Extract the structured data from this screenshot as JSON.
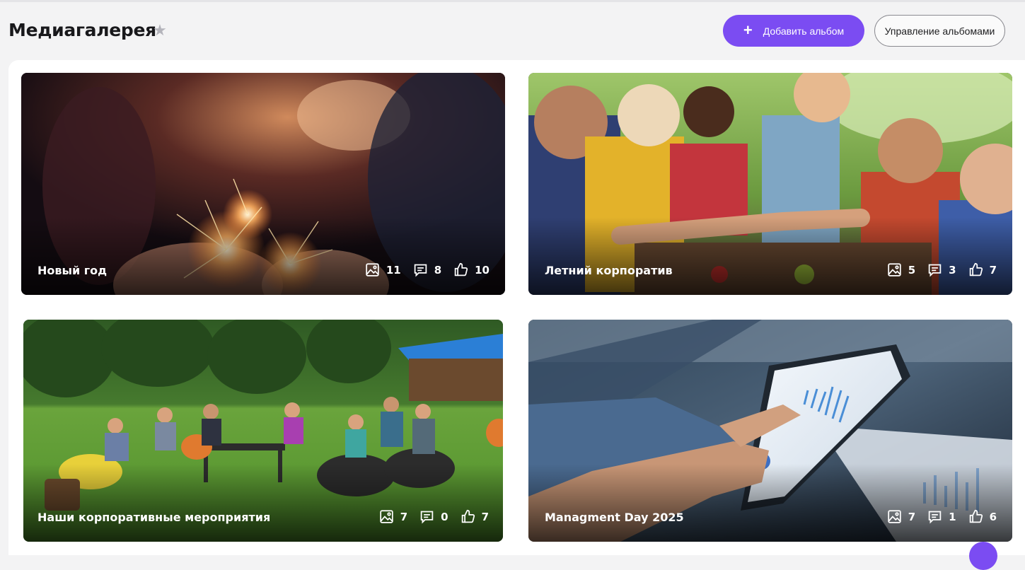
{
  "header": {
    "title": "Медиагалерея",
    "add_album_label": "Добавить альбом",
    "manage_albums_label": "Управление альбомами"
  },
  "icons": {
    "favorite": "star-icon",
    "add": "plus-icon",
    "photos": "image-icon",
    "comments": "comment-icon",
    "likes": "thumbs-up-icon"
  },
  "colors": {
    "accent": "#7b4cf2",
    "background": "#f3f3f4",
    "panel": "#ffffff"
  },
  "albums": [
    {
      "title": "Новый год",
      "photos": "11",
      "comments": "8",
      "likes": "10"
    },
    {
      "title": "Летний корпоратив",
      "photos": "5",
      "comments": "3",
      "likes": "7"
    },
    {
      "title": "Наши корпоративные мероприятия",
      "photos": "7",
      "comments": "0",
      "likes": "7"
    },
    {
      "title": "Managment Day 2025",
      "photos": "7",
      "comments": "1",
      "likes": "6"
    }
  ]
}
